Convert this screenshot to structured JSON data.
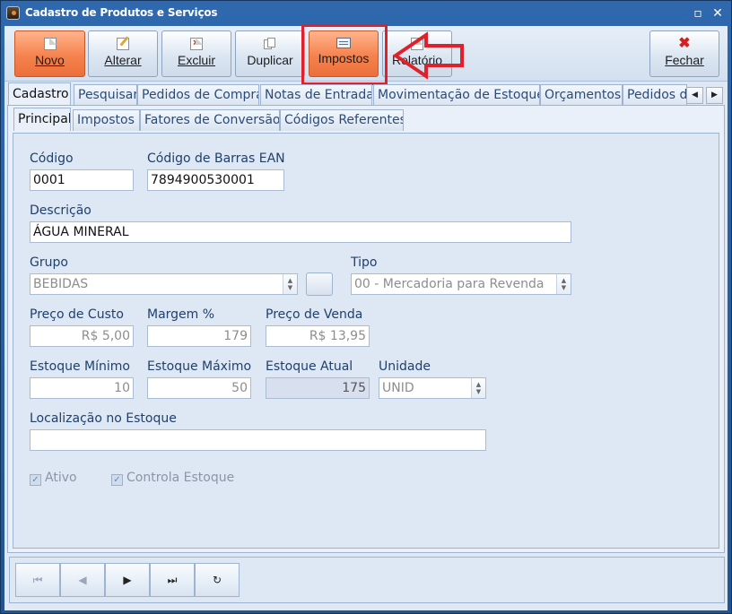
{
  "window": {
    "title": "Cadastro de Produtos e Serviços"
  },
  "toolbar": {
    "novo": "Novo",
    "alterar": "Alterar",
    "excluir": "Excluir",
    "duplicar": "Duplicar",
    "impostos": "Impostos",
    "relatorio": "Relatório",
    "fechar": "Fechar"
  },
  "tabs": [
    "Cadastro",
    "Pesquisar",
    "Pedidos de Compra",
    "Notas de Entrada",
    "Movimentação de Estoque",
    "Orçamentos",
    "Pedidos de"
  ],
  "subtabs": [
    "Principal",
    "Impostos",
    "Fatores de Conversão",
    "Códigos Referentes"
  ],
  "form": {
    "codigo_label": "Código",
    "codigo": "0001",
    "ean_label": "Código de Barras EAN",
    "ean": "7894900530001",
    "descricao_label": "Descrição",
    "descricao": "ÁGUA MINERAL",
    "grupo_label": "Grupo",
    "grupo": "BEBIDAS",
    "tipo_label": "Tipo",
    "tipo": "00 - Mercadoria para Revenda",
    "preco_custo_label": "Preço de Custo",
    "preco_custo": "R$ 5,00",
    "margem_label": "Margem %",
    "margem": "179",
    "preco_venda_label": "Preço de Venda",
    "preco_venda": "R$ 13,95",
    "estoque_min_label": "Estoque Mínimo",
    "estoque_min": "10",
    "estoque_max_label": "Estoque Máximo",
    "estoque_max": "50",
    "estoque_atual_label": "Estoque Atual",
    "estoque_atual": "175",
    "unidade_label": "Unidade",
    "unidade": "UNID",
    "localizacao_label": "Localização no Estoque",
    "localizacao": "",
    "ativo_label": "Ativo",
    "controla_label": "Controla Estoque"
  },
  "nav": {
    "first": "⏮",
    "prev": "◀",
    "next": "▶",
    "last": "⏭",
    "refresh": "↻"
  },
  "colors": {
    "highlight": "#e0202a",
    "hot_button": "#f5824e",
    "titlebar": "#2f68ad"
  }
}
